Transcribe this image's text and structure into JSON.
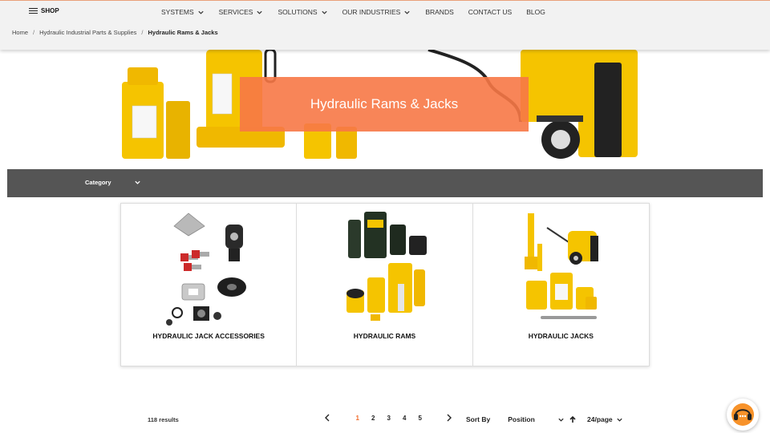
{
  "header": {
    "shop_label": "SHOP",
    "nav": [
      {
        "label": "SYSTEMS",
        "has_dropdown": true
      },
      {
        "label": "SERVICES",
        "has_dropdown": true
      },
      {
        "label": "SOLUTIONS",
        "has_dropdown": true
      },
      {
        "label": "OUR INDUSTRIES",
        "has_dropdown": true
      },
      {
        "label": "BRANDS",
        "has_dropdown": false
      },
      {
        "label": "CONTACT US",
        "has_dropdown": false
      },
      {
        "label": "BLOG",
        "has_dropdown": false
      }
    ]
  },
  "breadcrumb": {
    "home": "Home",
    "parent": "Hydraulic Industrial Parts & Supplies",
    "current": "Hydraulic Rams & Jacks",
    "separator": "/"
  },
  "banner": {
    "title": "Hydraulic Rams & Jacks"
  },
  "filter": {
    "category_label": "Category"
  },
  "products": [
    {
      "name": "HYDRAULIC JACK ACCESSORIES"
    },
    {
      "name": "HYDRAULIC RAMS"
    },
    {
      "name": "HYDRAULIC JACKS"
    }
  ],
  "toolbar": {
    "results": "118 results",
    "pages": [
      "1",
      "2",
      "3",
      "4",
      "5"
    ],
    "current_page": "1",
    "sort_label": "Sort By",
    "sort_value": "Position",
    "per_page": "24/page"
  },
  "colors": {
    "accent": "#f26b2a",
    "banner_overlay": "#f7784a",
    "filter_bar": "#555555",
    "product_yellow": "#f5c400"
  },
  "icons": {
    "menu": "hamburger-icon",
    "dropdown": "chevron-down-icon",
    "prev": "chevron-left-icon",
    "next": "chevron-right-icon",
    "sort_direction": "arrow-up-icon",
    "chat": "headset-chat-icon"
  }
}
